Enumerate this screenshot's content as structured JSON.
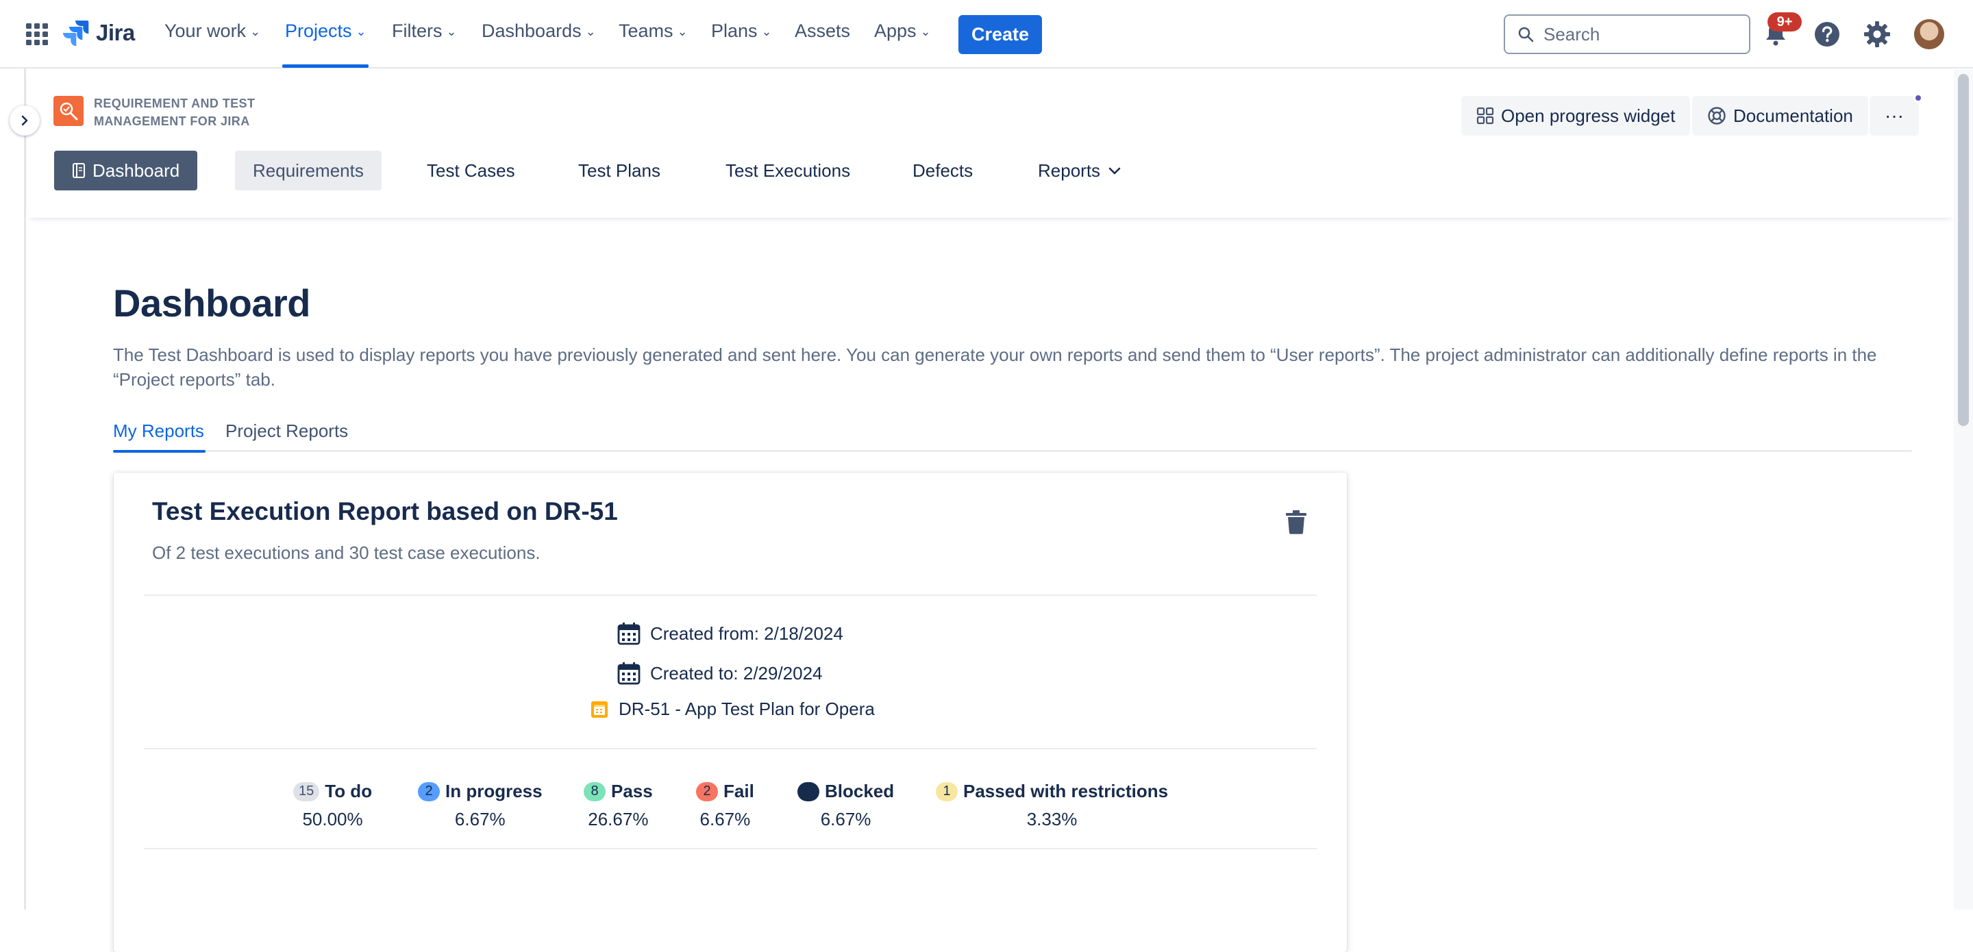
{
  "topnav": {
    "logo_text": "Jira",
    "items": [
      {
        "label": "Your work",
        "chevron": true
      },
      {
        "label": "Projects",
        "chevron": true
      },
      {
        "label": "Filters",
        "chevron": true
      },
      {
        "label": "Dashboards",
        "chevron": true
      },
      {
        "label": "Teams",
        "chevron": true
      },
      {
        "label": "Plans",
        "chevron": true
      },
      {
        "label": "Assets",
        "chevron": false
      },
      {
        "label": "Apps",
        "chevron": true
      }
    ],
    "active_item": "Projects",
    "create_label": "Create",
    "search_placeholder": "Search",
    "notification_count": "9+",
    "accent_color": "#0c66e4"
  },
  "app_header": {
    "app_name": "REQUIREMENT AND TEST MANAGEMENT FOR JIRA",
    "open_progress_label": "Open progress widget",
    "documentation_label": "Documentation",
    "more_label": "···",
    "tabs": [
      {
        "label": "Dashboard"
      },
      {
        "label": "Requirements"
      },
      {
        "label": "Test Cases"
      },
      {
        "label": "Test Plans"
      },
      {
        "label": "Test Executions"
      },
      {
        "label": "Defects"
      },
      {
        "label": "Reports"
      }
    ],
    "active_tab": "Dashboard"
  },
  "main": {
    "title": "Dashboard",
    "description": "The Test Dashboard is used to display reports you have previously generated and sent here. You can generate your own reports and send them to “User reports”. The project administrator can additionally define reports in the “Project reports” tab.",
    "tabs": [
      {
        "label": "My Reports"
      },
      {
        "label": "Project Reports"
      }
    ],
    "active_tab": "My Reports"
  },
  "report": {
    "title": "Test Execution Report based on DR-51",
    "subtitle": "Of 2 test executions and 30 test case executions.",
    "created_from": "Created from: 2/18/2024",
    "created_to": "Created to: 2/29/2024",
    "test_plan": "DR-51 - App Test Plan for Opera",
    "stats": [
      {
        "count": "15",
        "label": "To do",
        "percent": "50.00%",
        "badge_bg": "#dfe1e6",
        "badge_fg": "#42526e"
      },
      {
        "count": "2",
        "label": "In progress",
        "percent": "6.67%",
        "badge_bg": "#579dff",
        "badge_fg": "#172b4d"
      },
      {
        "count": "8",
        "label": "Pass",
        "percent": "26.67%",
        "badge_bg": "#7ee2b8",
        "badge_fg": "#172b4d"
      },
      {
        "count": "2",
        "label": "Fail",
        "percent": "6.67%",
        "badge_bg": "#f87462",
        "badge_fg": "#172b4d"
      },
      {
        "count": "",
        "label": "Blocked",
        "percent": "6.67%",
        "badge_bg": "#172b4d",
        "badge_fg": "#ffffff"
      },
      {
        "count": "1",
        "label": "Passed with restrictions",
        "percent": "3.33%",
        "badge_bg": "#f8e6a0",
        "badge_fg": "#172b4d"
      }
    ]
  }
}
